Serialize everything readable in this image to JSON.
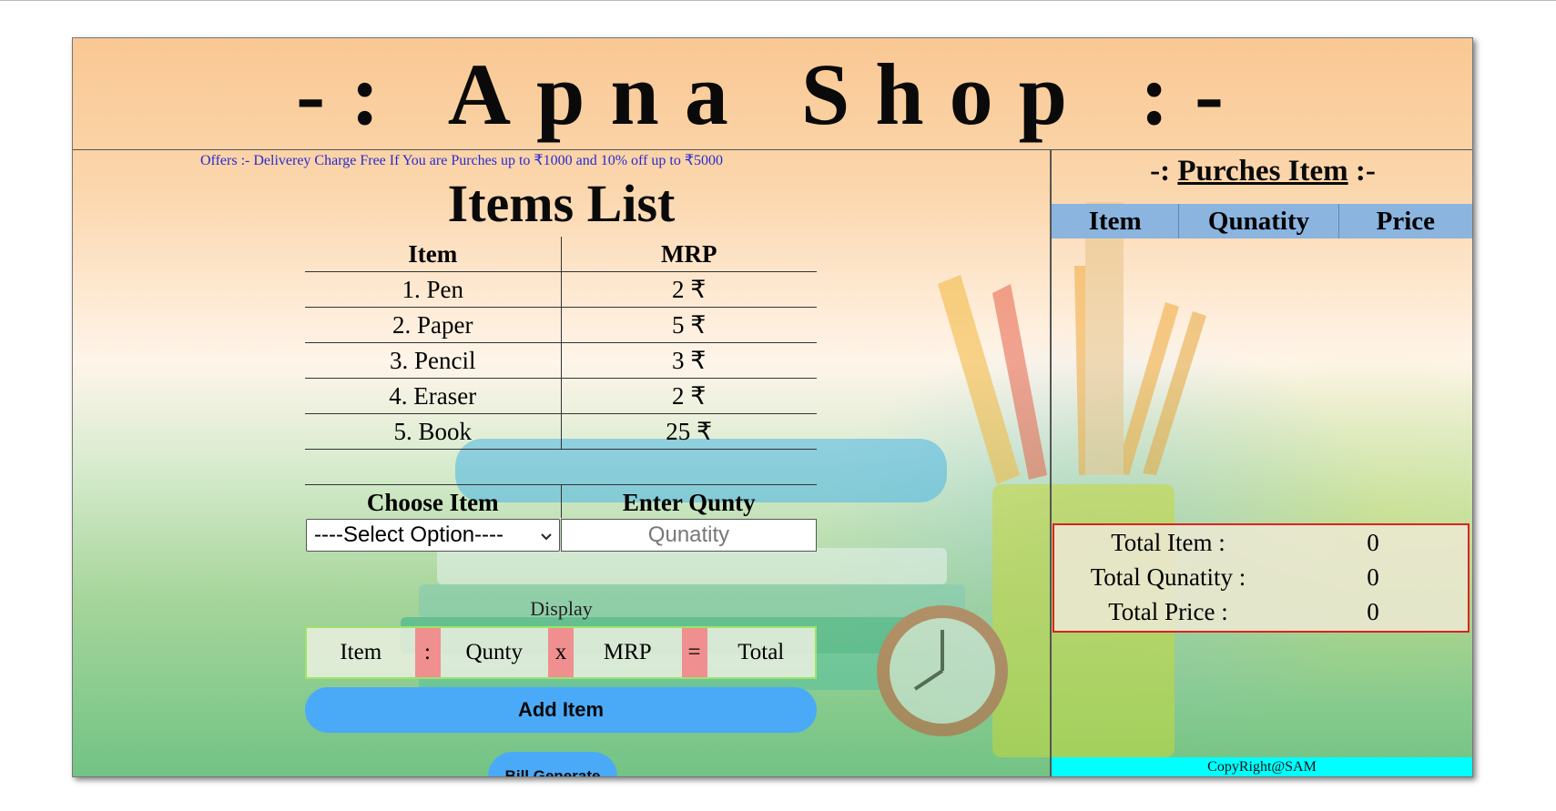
{
  "header": {
    "title": "-: Apna Shop :-"
  },
  "offers": "Offers :- Deliverey Charge Free If You are Purches up to ₹1000 and 10% off up to ₹5000",
  "items_list": {
    "title": "Items List",
    "columns": [
      "Item",
      "MRP"
    ],
    "rows": [
      {
        "item": "1. Pen",
        "mrp": "2 ₹"
      },
      {
        "item": "2. Paper",
        "mrp": "5 ₹"
      },
      {
        "item": "3. Pencil",
        "mrp": "3 ₹"
      },
      {
        "item": "4. Eraser",
        "mrp": "2 ₹"
      },
      {
        "item": "5. Book",
        "mrp": "25 ₹"
      }
    ]
  },
  "chooser": {
    "choose_label": "Choose Item",
    "qty_label": "Enter Qunty",
    "select_value": "----Select Option----",
    "qty_placeholder": "Qunatity"
  },
  "display": {
    "label": "Display",
    "item": "Item",
    "sep1": ":",
    "qty": "Qunty",
    "sep2": "x",
    "mrp": "MRP",
    "sep3": "=",
    "total": "Total"
  },
  "buttons": {
    "add": "Add Item",
    "bill": "Bill Generate"
  },
  "purchase": {
    "title_prefix": "-: ",
    "title_main": "Purches Item",
    "title_suffix": " :-",
    "columns": [
      "Item",
      "Qunatity",
      "Price"
    ]
  },
  "totals": {
    "total_item_label": "Total Item :",
    "total_item_value": "0",
    "total_qty_label": "Total Qunatity :",
    "total_qty_value": "0",
    "total_price_label": "Total Price :",
    "total_price_value": "0"
  },
  "footer": {
    "copyright": "CopyRight@SAM"
  },
  "colors": {
    "table_header": "#8bb4df",
    "button": "#4aaaf7",
    "operator": "#f08f8f",
    "copyright_bar": "#00ffff",
    "offers_text": "#2a2acf"
  }
}
